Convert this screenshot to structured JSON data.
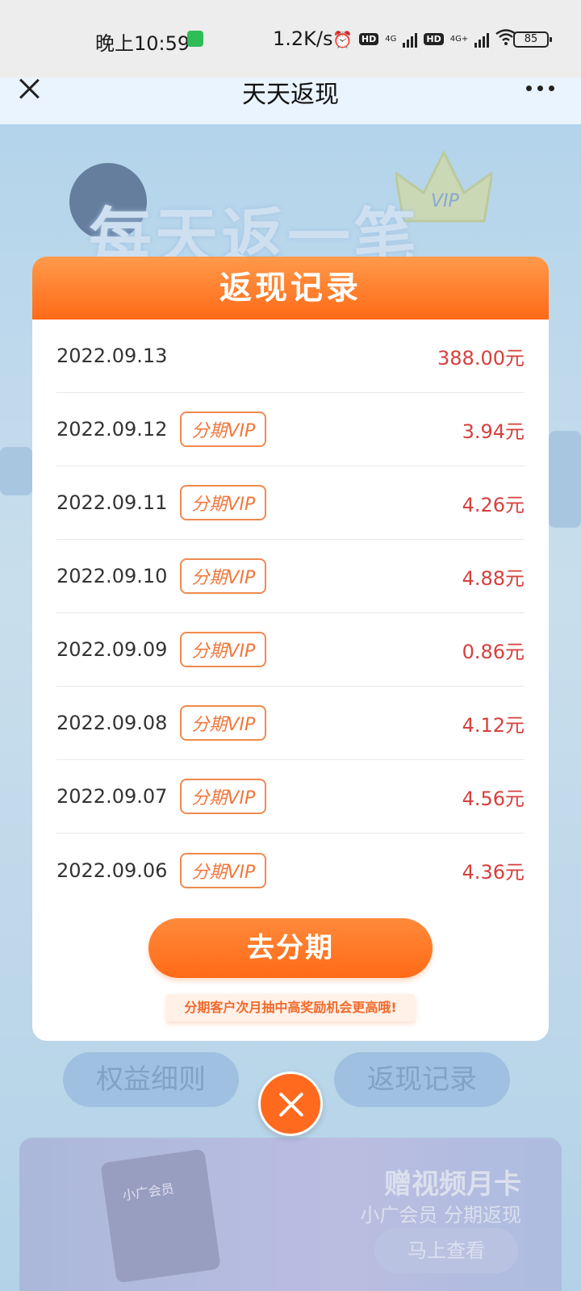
{
  "status_bar": {
    "time": "晚上10:59",
    "speed": "1.2K/s",
    "net1": "4G",
    "net2": "4G+",
    "hd": "HD",
    "battery": "85"
  },
  "nav": {
    "title": "天天返现"
  },
  "background": {
    "banner_text": "每天返一笔",
    "vip": "VIP",
    "left_button": "权益细则",
    "right_button": "返现记录",
    "card_title": "赠视频月卡",
    "card_subtitle": "小广会员 分期返现",
    "card_button": "马上查看",
    "card_logo": "小广会员"
  },
  "modal": {
    "title": "返现记录",
    "records": [
      {
        "date": "2022.09.13",
        "tag": "",
        "amount": "388.00元"
      },
      {
        "date": "2022.09.12",
        "tag": "分期VIP",
        "amount": "3.94元"
      },
      {
        "date": "2022.09.11",
        "tag": "分期VIP",
        "amount": "4.26元"
      },
      {
        "date": "2022.09.10",
        "tag": "分期VIP",
        "amount": "4.88元"
      },
      {
        "date": "2022.09.09",
        "tag": "分期VIP",
        "amount": "0.86元"
      },
      {
        "date": "2022.09.08",
        "tag": "分期VIP",
        "amount": "4.12元"
      },
      {
        "date": "2022.09.07",
        "tag": "分期VIP",
        "amount": "4.56元"
      },
      {
        "date": "2022.09.06",
        "tag": "分期VIP",
        "amount": "4.36元"
      }
    ],
    "button": "去分期",
    "hint": "分期客户次月抽中高奖励机会更高哦!"
  },
  "colors": {
    "accent": "#ff6a17",
    "amount": "#d6403d",
    "tag_border": "#f08a4e"
  }
}
